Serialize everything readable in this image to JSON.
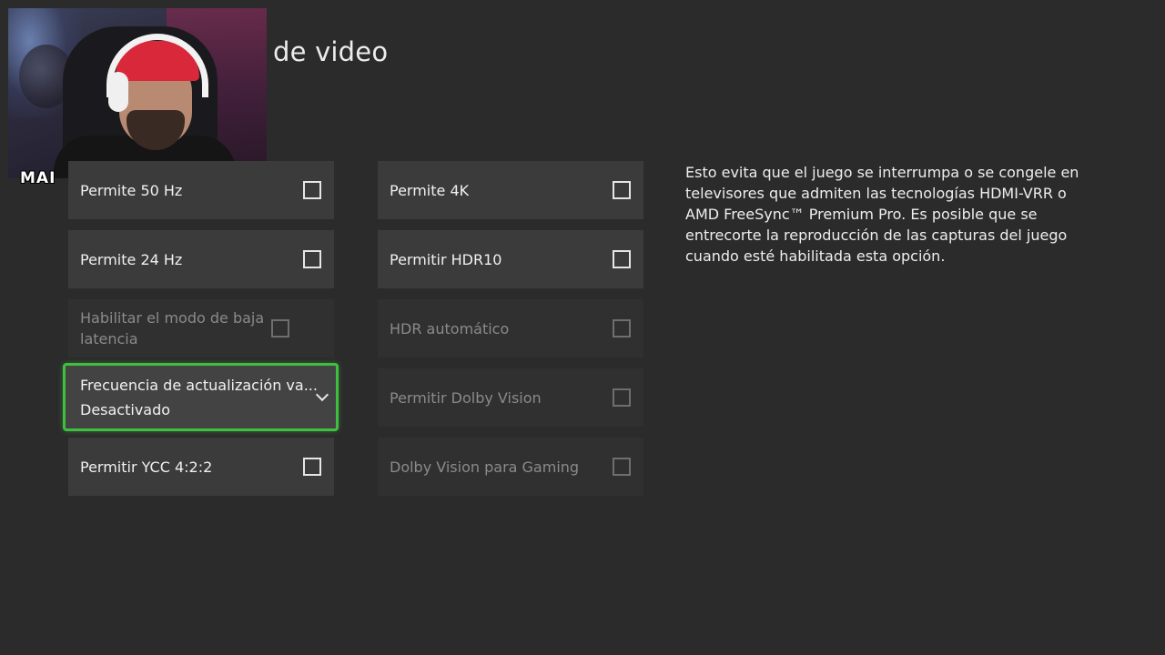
{
  "page": {
    "title": "de video"
  },
  "webcam": {
    "tag": "MAI"
  },
  "settings": {
    "left_column": {
      "permite_50hz": {
        "label": "Permite 50 Hz",
        "checked": false,
        "enabled": true
      },
      "permite_24hz": {
        "label": "Permite 24 Hz",
        "checked": false,
        "enabled": true
      },
      "baja_latencia": {
        "label": "Habilitar el modo de baja latencia",
        "checked": false,
        "enabled": false
      },
      "vrr": {
        "label": "Frecuencia de actualización va...",
        "value": "Desactivado",
        "focused": true
      },
      "ycc": {
        "label": "Permitir YCC 4:2:2",
        "checked": false,
        "enabled": true
      }
    },
    "right_column": {
      "permite_4k": {
        "label": "Permite 4K",
        "checked": false,
        "enabled": true
      },
      "hdr10": {
        "label": "Permitir HDR10",
        "checked": false,
        "enabled": true
      },
      "auto_hdr": {
        "label": "HDR automático",
        "checked": false,
        "enabled": false
      },
      "dolby_vision": {
        "label": "Permitir Dolby Vision",
        "checked": false,
        "enabled": false
      },
      "dolby_gaming": {
        "label": "Dolby Vision para Gaming",
        "checked": false,
        "enabled": false
      }
    }
  },
  "description": "Esto evita que el juego se interrumpa o se congele en televisores que admiten las tecnologías HDMI-VRR o AMD FreeSync™ Premium Pro. Es posible que se entrecorte la reproducción de las capturas del juego cuando esté habilitada esta opción.",
  "colors": {
    "background": "#2b2b2b",
    "tile": "#3b3b3b",
    "tile_disabled": "#303030",
    "focus_ring": "#3fbf3f"
  }
}
